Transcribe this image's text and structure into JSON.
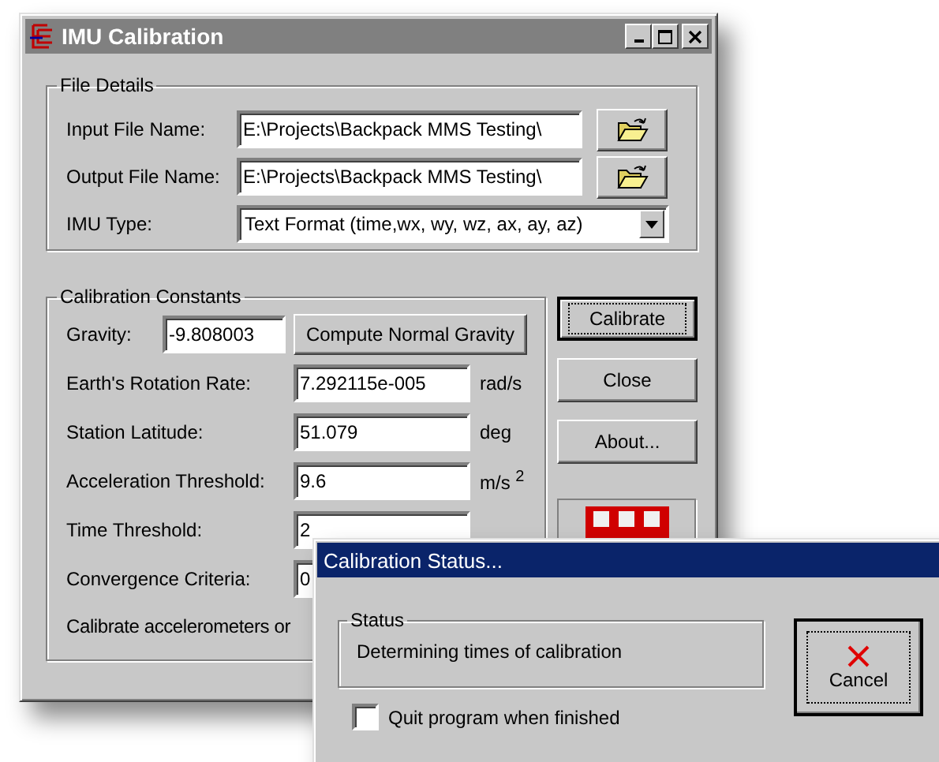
{
  "main_window": {
    "title": "IMU Calibration",
    "file_details": {
      "title": "File Details",
      "files": [
        {
          "label": "Input File Name:",
          "value": "E:\\Projects\\Backpack MMS Testing\\"
        },
        {
          "label": "Output File Name:",
          "value": "E:\\Projects\\Backpack MMS Testing\\"
        }
      ],
      "imu_type": {
        "label": "IMU Type:",
        "value": "Text Format (time,wx, wy, wz, ax, ay, az)"
      }
    },
    "calibration_constants": {
      "title": "Calibration Constants",
      "gravity": {
        "label": "Gravity:",
        "value": "-9.808003"
      },
      "compute_button": "Compute Normal Gravity",
      "fields": [
        {
          "label": "Earth's Rotation Rate:",
          "value": "7.292115e-005",
          "unit": "rad/s"
        },
        {
          "label": "Station Latitude:",
          "value": "51.079",
          "unit": "deg"
        },
        {
          "label": "Acceleration Threshold:",
          "value": "9.6",
          "unit": "m/s $^{2}$"
        },
        {
          "label": "Time Threshold:",
          "value": "2"
        },
        {
          "label": "Convergence Criteria:",
          "value": "0"
        }
      ],
      "note": "Calibrate accelerometers or"
    },
    "buttons": [
      {
        "label": "Calibrate",
        "focused": true
      },
      {
        "label": "Close",
        "focused": false
      },
      {
        "label": "About...",
        "focused": false
      }
    ]
  },
  "status_dialog": {
    "title": "Calibration Status...",
    "status_group": "Status",
    "status_text": "Determining times of calibration",
    "quit_checkbox": {
      "label": "Quit program when finished",
      "checked": false
    },
    "cancel_button": "Cancel"
  }
}
